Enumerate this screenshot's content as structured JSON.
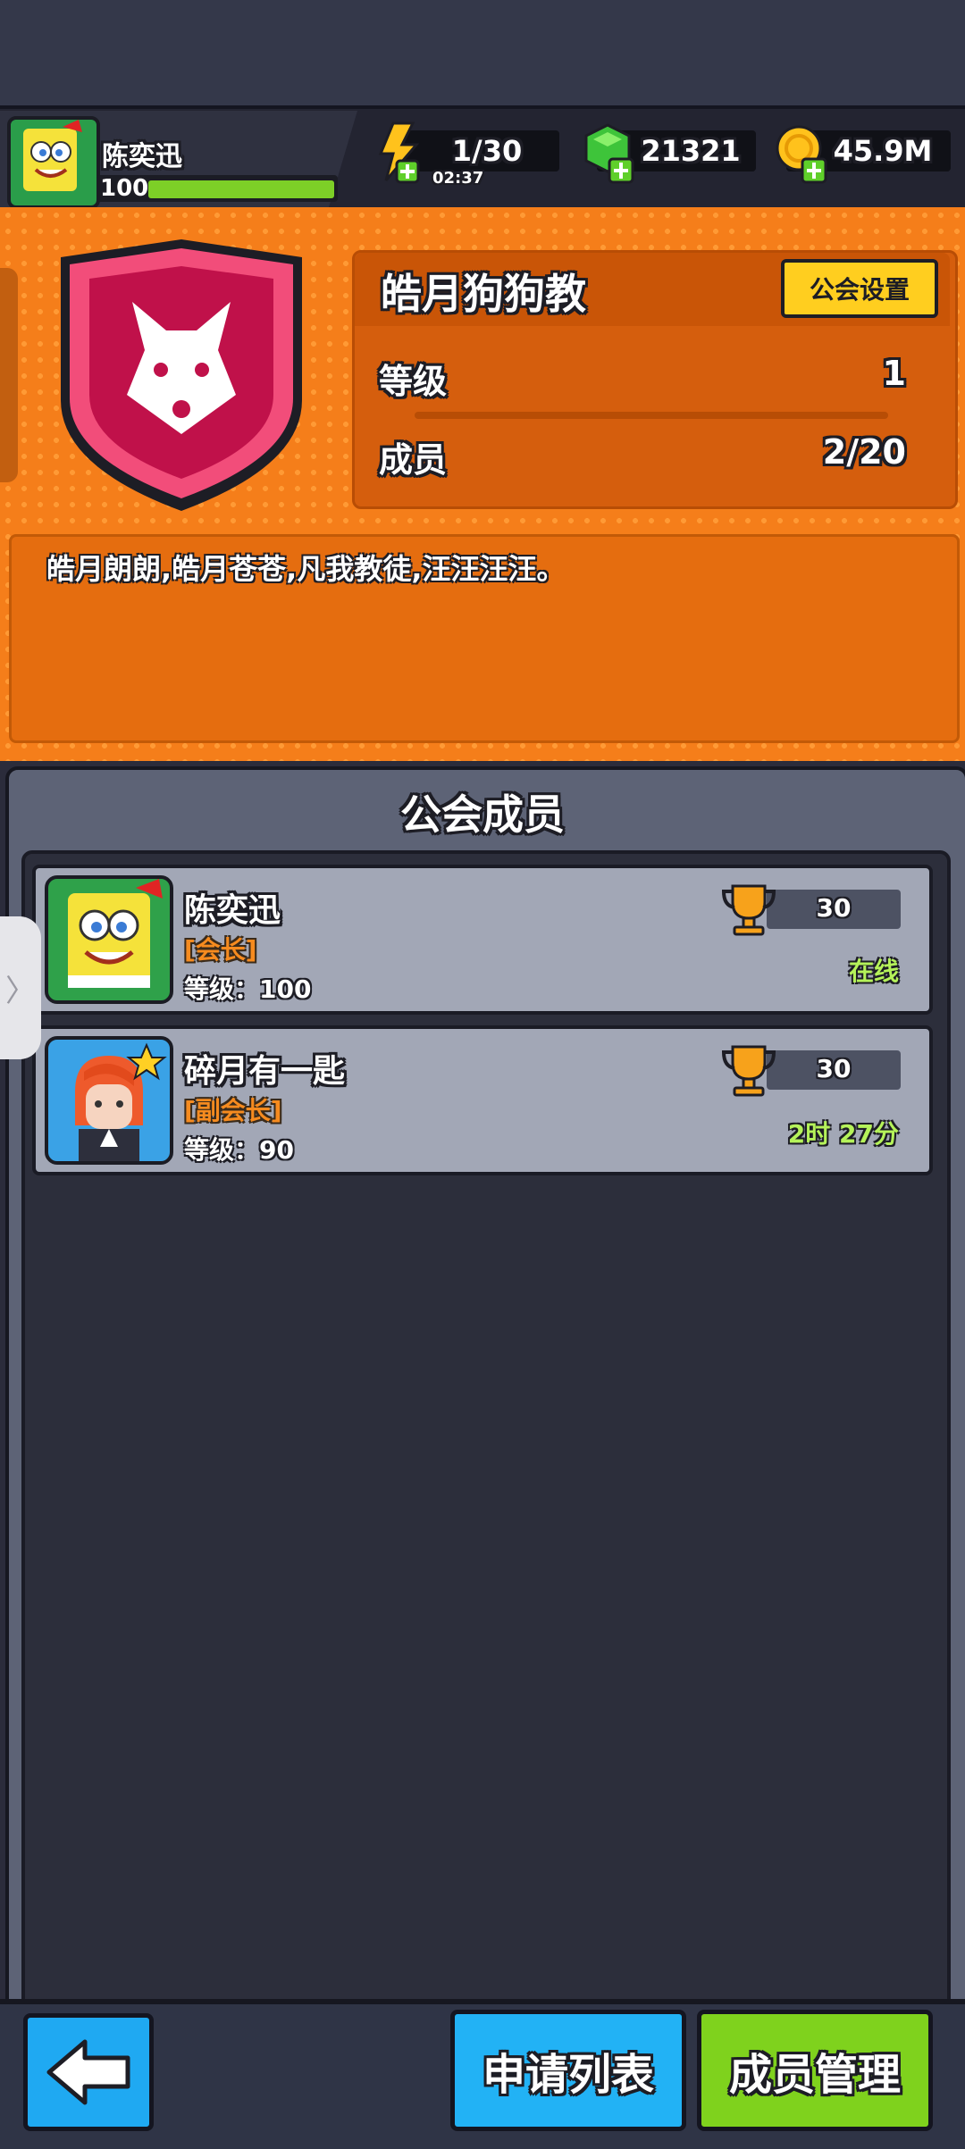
{
  "player": {
    "name": "陈奕迅",
    "level": "100"
  },
  "resources": {
    "energy": "1/30",
    "energy_timer": "02:37",
    "gems": "21321",
    "coins": "45.9M"
  },
  "guild": {
    "name": "皓月狗狗教",
    "settings_label": "公会设置",
    "level_label": "等级",
    "level_value": "1",
    "members_label": "成员",
    "members_value": "2/20",
    "motto": "皓月朗朗,皓月苍苍,凡我教徒,汪汪汪汪。"
  },
  "members_panel": {
    "title": "公会成员",
    "members": [
      {
        "name": "陈奕迅",
        "role": "[会长]",
        "level": "等级：100",
        "trophies": "30",
        "status": "在线"
      },
      {
        "name": "碎月有一匙",
        "role": "[副会长]",
        "level": "等级：90",
        "trophies": "30",
        "status": "2时 27分"
      }
    ]
  },
  "bottom": {
    "apply_label": "申请列表",
    "manage_label": "成员管理"
  },
  "icons": {
    "energy": "lightning-plus-icon",
    "gem": "green-gem-plus-icon",
    "coin": "gold-coin-plus-icon",
    "emblem": "wolf-shield-emblem",
    "trophy": "trophy-icon",
    "back": "arrow-left-icon"
  },
  "colors": {
    "accent_orange": "#f57e1a",
    "button_blue": "#22b2f5",
    "button_green": "#7fd21d",
    "settings_yellow": "#ffce1f"
  }
}
